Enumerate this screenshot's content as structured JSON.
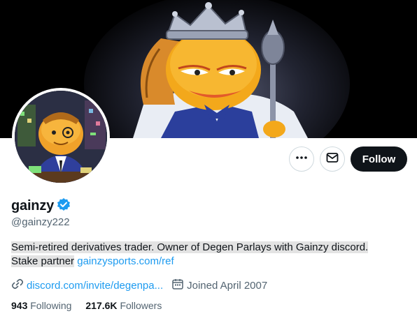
{
  "profile": {
    "display_name": "gainzy",
    "handle": "@gainzy222",
    "bio_text": "Semi-retired derivatives trader. Owner of Degen Parlays with Gainzy discord.",
    "bio_text_2": "Stake partner",
    "bio_link": "gainzysports.com/ref",
    "website": "discord.com/invite/degenpa...",
    "joined": "Joined April 2007",
    "following_count": "943",
    "following_label": "Following",
    "followers_count": "217.6K",
    "followers_label": "Followers",
    "verified_icon": "verified-badge-icon"
  },
  "actions": {
    "more_icon": "more-icon",
    "message_icon": "envelope-icon",
    "follow_label": "Follow"
  },
  "colors": {
    "accent": "#1d9bf0",
    "text": "#0f1419",
    "secondary": "#536471",
    "follow_bg": "#0f1419"
  }
}
